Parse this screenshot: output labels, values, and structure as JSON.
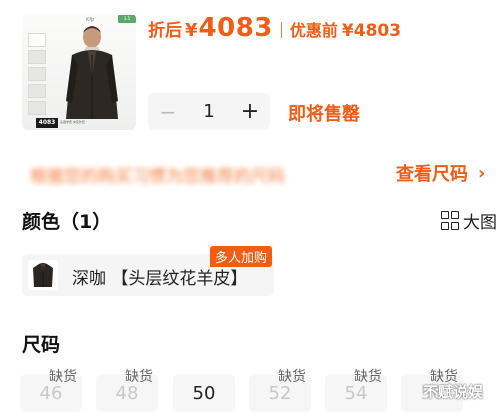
{
  "product": {
    "thumbnail_brand": "Kfp",
    "thumbnail_tag": "3.5",
    "thumbnail_price": "4083",
    "thumbnail_caption": "头层羊皮 夹克外套"
  },
  "price": {
    "discount_label": "折后",
    "currency": "¥",
    "discount_amount": "4083",
    "original_label": "优惠前",
    "original_price": "¥4803"
  },
  "quantity": {
    "minus": "−",
    "value": "1",
    "plus": "+"
  },
  "stock_status": "即将售罄",
  "notice_blurred": "根据您的购买习惯为您推荐的尺码",
  "size_chart_link": "查看尺码",
  "size_chart_chevron": "›",
  "color_section": {
    "title": "颜色（1）",
    "large_image_label": "大图",
    "options": [
      {
        "label": "深咖 【头层纹花羊皮】",
        "badge": "多人加购"
      }
    ]
  },
  "size_section": {
    "title": "尺码",
    "out_of_stock_label": "缺货",
    "sizes": [
      {
        "value": "46",
        "status": "缺货"
      },
      {
        "value": "48",
        "status": "缺货"
      },
      {
        "value": "50",
        "status": ""
      },
      {
        "value": "52",
        "status": "缺货"
      },
      {
        "value": "54",
        "status": "缺货"
      },
      {
        "value": "56",
        "status": "缺货"
      }
    ]
  },
  "watermark": "不赋说娱",
  "colors": {
    "accent": "#f25c14",
    "cell_bg": "#f5f5f5",
    "text": "#222222",
    "disabled": "#c8c8c8"
  }
}
